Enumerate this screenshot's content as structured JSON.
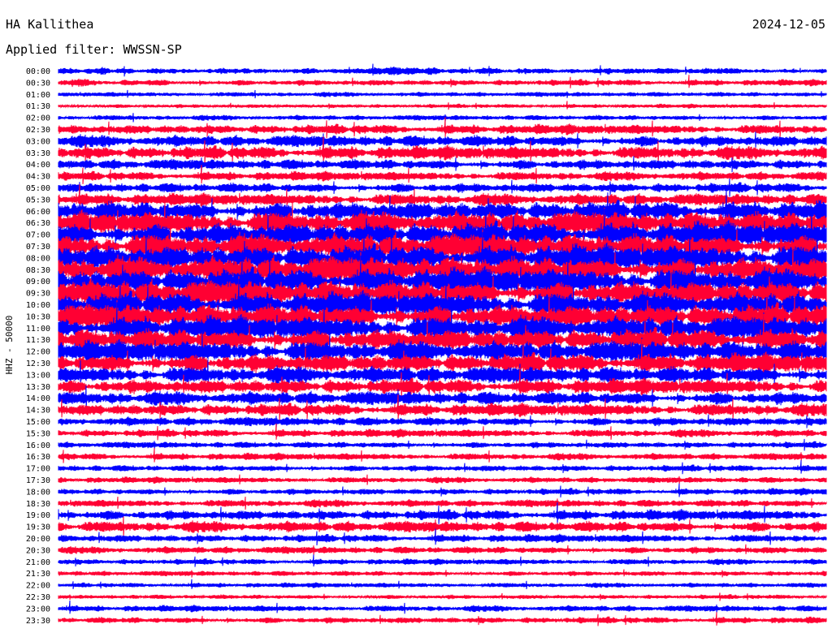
{
  "header": {
    "station": "HA Kallithea",
    "date": "2024-12-05",
    "filter_label": "Applied filter: WWSSN-SP",
    "channel": "HHZ - 50000"
  },
  "chart_data": {
    "type": "line",
    "title": "HA Kallithea",
    "ylabel": "HHZ - 50000",
    "row_labels": [
      "00:00",
      "00:30",
      "01:00",
      "01:30",
      "02:00",
      "02:30",
      "03:00",
      "03:30",
      "04:00",
      "04:30",
      "05:00",
      "05:30",
      "06:00",
      "06:30",
      "07:00",
      "07:30",
      "08:00",
      "08:30",
      "09:00",
      "09:30",
      "10:00",
      "10:30",
      "11:00",
      "11:30",
      "12:00",
      "12:30",
      "13:00",
      "13:30",
      "14:00",
      "14:30",
      "15:00",
      "15:30",
      "16:00",
      "16:30",
      "17:00",
      "17:30",
      "18:00",
      "18:30",
      "19:00",
      "19:30",
      "20:00",
      "20:30",
      "21:00",
      "21:30",
      "22:00",
      "22:30",
      "23:00",
      "23:30"
    ],
    "series_colors": [
      "#0000ff",
      "#ff0033"
    ],
    "relative_amplitude": [
      0.55,
      0.5,
      0.38,
      0.32,
      0.42,
      0.78,
      0.95,
      1.05,
      0.85,
      0.72,
      0.8,
      0.95,
      1.6,
      1.85,
      2.0,
      2.05,
      2.1,
      2.15,
      2.1,
      2.05,
      2.0,
      2.0,
      1.9,
      1.8,
      1.7,
      1.55,
      1.35,
      1.2,
      1.1,
      1.0,
      0.72,
      0.62,
      0.52,
      0.55,
      0.52,
      0.48,
      0.52,
      0.6,
      0.82,
      0.9,
      0.62,
      0.58,
      0.46,
      0.42,
      0.38,
      0.36,
      0.5,
      0.52
    ],
    "grid": false
  }
}
